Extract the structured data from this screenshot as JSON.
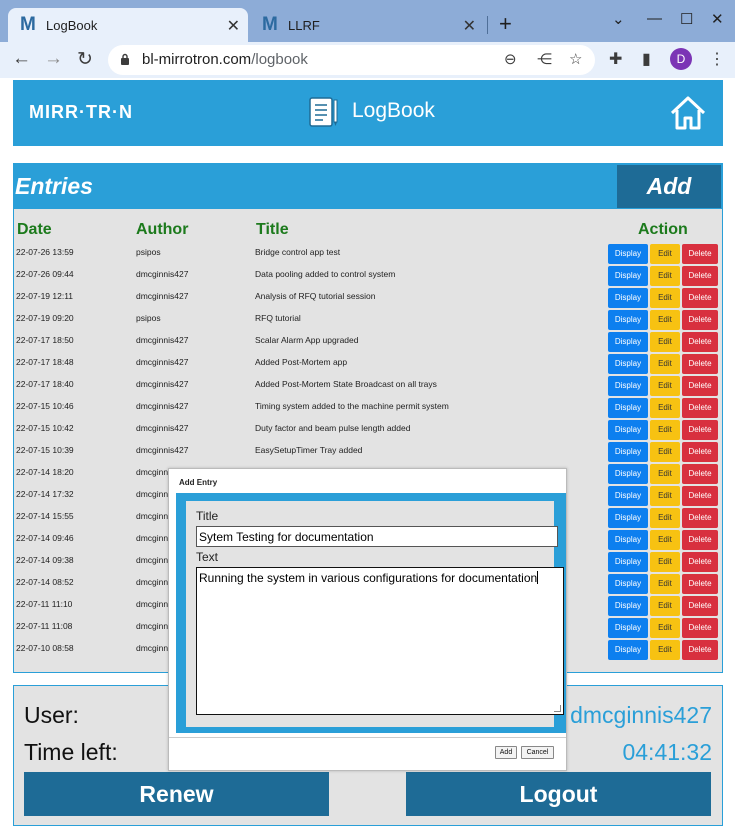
{
  "browser": {
    "tabs": [
      {
        "favicon": "M",
        "title": "LogBook"
      },
      {
        "favicon": "M",
        "title": "LLRF"
      }
    ],
    "url_domain": "bl-mirrotron.com",
    "url_path": "/logbook",
    "profile_initial": "D",
    "icons": {
      "close": "✕",
      "new_tab": "+",
      "minimize": "—",
      "maximize": "☐",
      "window_close": "✕",
      "back": "←",
      "forward": "→",
      "reload": "↻",
      "zoom": "⊖",
      "share": "⋲",
      "star": "☆",
      "extensions": "✚",
      "sidepanel": "▮",
      "menu": "⋮"
    }
  },
  "header": {
    "brand": "MIRR·TR·N",
    "title": "LogBook"
  },
  "entries": {
    "title": "Entries",
    "add_label": "Add",
    "columns": {
      "date": "Date",
      "author": "Author",
      "title": "Title",
      "action": "Action"
    },
    "buttons": {
      "display": "Display",
      "edit": "Edit",
      "delete": "Delete"
    },
    "rows": [
      {
        "date": "22-07-26 13:59",
        "author": "psipos",
        "title": "Bridge control app test"
      },
      {
        "date": "22-07-26 09:44",
        "author": "dmcginnis427",
        "title": "Data pooling added to control system"
      },
      {
        "date": "22-07-19 12:11",
        "author": "dmcginnis427",
        "title": "Analysis of RFQ tutorial session"
      },
      {
        "date": "22-07-19 09:20",
        "author": "psipos",
        "title": "RFQ tutorial"
      },
      {
        "date": "22-07-17 18:50",
        "author": "dmcginnis427",
        "title": "Scalar Alarm App upgraded"
      },
      {
        "date": "22-07-17 18:48",
        "author": "dmcginnis427",
        "title": "Added Post-Mortem app"
      },
      {
        "date": "22-07-17 18:40",
        "author": "dmcginnis427",
        "title": "Added Post-Mortem State Broadcast on all trays"
      },
      {
        "date": "22-07-15 10:46",
        "author": "dmcginnis427",
        "title": "Timing system added to the machine permit system"
      },
      {
        "date": "22-07-15 10:42",
        "author": "dmcginnis427",
        "title": "Duty factor and beam pulse length added"
      },
      {
        "date": "22-07-15 10:39",
        "author": "dmcginnis427",
        "title": "EasySetupTimer Tray added"
      },
      {
        "date": "22-07-14 18:20",
        "author": "dmcginnis427",
        "title": ""
      },
      {
        "date": "22-07-14 17:32",
        "author": "dmcginnis427",
        "title": ""
      },
      {
        "date": "22-07-14 15:55",
        "author": "dmcginnis427",
        "title": ""
      },
      {
        "date": "22-07-14 09:46",
        "author": "dmcginnis427",
        "title": ""
      },
      {
        "date": "22-07-14 09:38",
        "author": "dmcginnis427",
        "title": ""
      },
      {
        "date": "22-07-14 08:52",
        "author": "dmcginnis427",
        "title": ""
      },
      {
        "date": "22-07-11 11:10",
        "author": "dmcginnis427",
        "title": ""
      },
      {
        "date": "22-07-11 11:08",
        "author": "dmcginnis427",
        "title": ""
      },
      {
        "date": "22-07-10 08:58",
        "author": "dmcginnis427",
        "title": ""
      }
    ]
  },
  "session": {
    "user_label": "User:",
    "user_value": "dmcginnis427",
    "time_label": "Time left:",
    "time_value": "04:41:32",
    "renew_label": "Renew",
    "logout_label": "Logout"
  },
  "modal": {
    "title": "Add Entry",
    "title_field_label": "Title",
    "title_field_value": "Sytem Testing for documentation",
    "text_field_label": "Text",
    "text_field_value": "Running the system in various configurations for documentation",
    "add_label": "Add",
    "cancel_label": "Cancel"
  },
  "colors": {
    "primary": "#2a9fd8",
    "dark": "#1e6b96",
    "header_green": "#1c7a1c",
    "display": "#0d7fef",
    "edit": "#f7c212",
    "delete": "#d8303f"
  }
}
